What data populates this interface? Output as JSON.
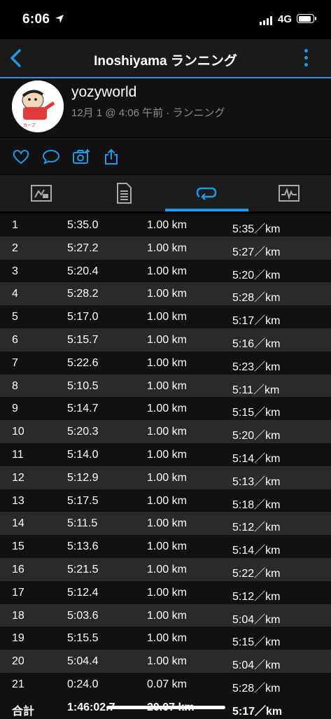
{
  "status": {
    "time": "6:06",
    "network": "4G"
  },
  "nav": {
    "title": "Inoshiyama ランニング"
  },
  "profile": {
    "username": "yozyworld",
    "meta": "12月 1 @ 4:06 午前 · ランニング"
  },
  "colors": {
    "accent": "#1e9be4",
    "background": "#000000",
    "row_alt": "#2a2a2a",
    "secondary_text": "#8e8e8e"
  },
  "icons": {
    "actions": [
      "heart-icon",
      "comment-icon",
      "camera-icon",
      "share-icon"
    ],
    "tabs": [
      "overview-icon",
      "details-icon",
      "laps-icon",
      "charts-icon"
    ]
  },
  "laps": [
    {
      "lap": "1",
      "time": "5:35.0",
      "distance": "1.00 km",
      "pace": "5:35／km"
    },
    {
      "lap": "2",
      "time": "5:27.2",
      "distance": "1.00 km",
      "pace": "5:27／km"
    },
    {
      "lap": "3",
      "time": "5:20.4",
      "distance": "1.00 km",
      "pace": "5:20／km"
    },
    {
      "lap": "4",
      "time": "5:28.2",
      "distance": "1.00 km",
      "pace": "5:28／km"
    },
    {
      "lap": "5",
      "time": "5:17.0",
      "distance": "1.00 km",
      "pace": "5:17／km"
    },
    {
      "lap": "6",
      "time": "5:15.7",
      "distance": "1.00 km",
      "pace": "5:16／km"
    },
    {
      "lap": "7",
      "time": "5:22.6",
      "distance": "1.00 km",
      "pace": "5:23／km"
    },
    {
      "lap": "8",
      "time": "5:10.5",
      "distance": "1.00 km",
      "pace": "5:11／km"
    },
    {
      "lap": "9",
      "time": "5:14.7",
      "distance": "1.00 km",
      "pace": "5:15／km"
    },
    {
      "lap": "10",
      "time": "5:20.3",
      "distance": "1.00 km",
      "pace": "5:20／km"
    },
    {
      "lap": "11",
      "time": "5:14.0",
      "distance": "1.00 km",
      "pace": "5:14／km"
    },
    {
      "lap": "12",
      "time": "5:12.9",
      "distance": "1.00 km",
      "pace": "5:13／km"
    },
    {
      "lap": "13",
      "time": "5:17.5",
      "distance": "1.00 km",
      "pace": "5:18／km"
    },
    {
      "lap": "14",
      "time": "5:11.5",
      "distance": "1.00 km",
      "pace": "5:12／km"
    },
    {
      "lap": "15",
      "time": "5:13.6",
      "distance": "1.00 km",
      "pace": "5:14／km"
    },
    {
      "lap": "16",
      "time": "5:21.5",
      "distance": "1.00 km",
      "pace": "5:22／km"
    },
    {
      "lap": "17",
      "time": "5:12.4",
      "distance": "1.00 km",
      "pace": "5:12／km"
    },
    {
      "lap": "18",
      "time": "5:03.6",
      "distance": "1.00 km",
      "pace": "5:04／km"
    },
    {
      "lap": "19",
      "time": "5:15.5",
      "distance": "1.00 km",
      "pace": "5:15／km"
    },
    {
      "lap": "20",
      "time": "5:04.4",
      "distance": "1.00 km",
      "pace": "5:04／km"
    },
    {
      "lap": "21",
      "time": "0:24.0",
      "distance": "0.07 km",
      "pace": "5:28／km"
    }
  ],
  "total": {
    "label": "合計",
    "time": "1:46:02.7",
    "distance": "20.07 km",
    "pace": "5:17／km"
  }
}
